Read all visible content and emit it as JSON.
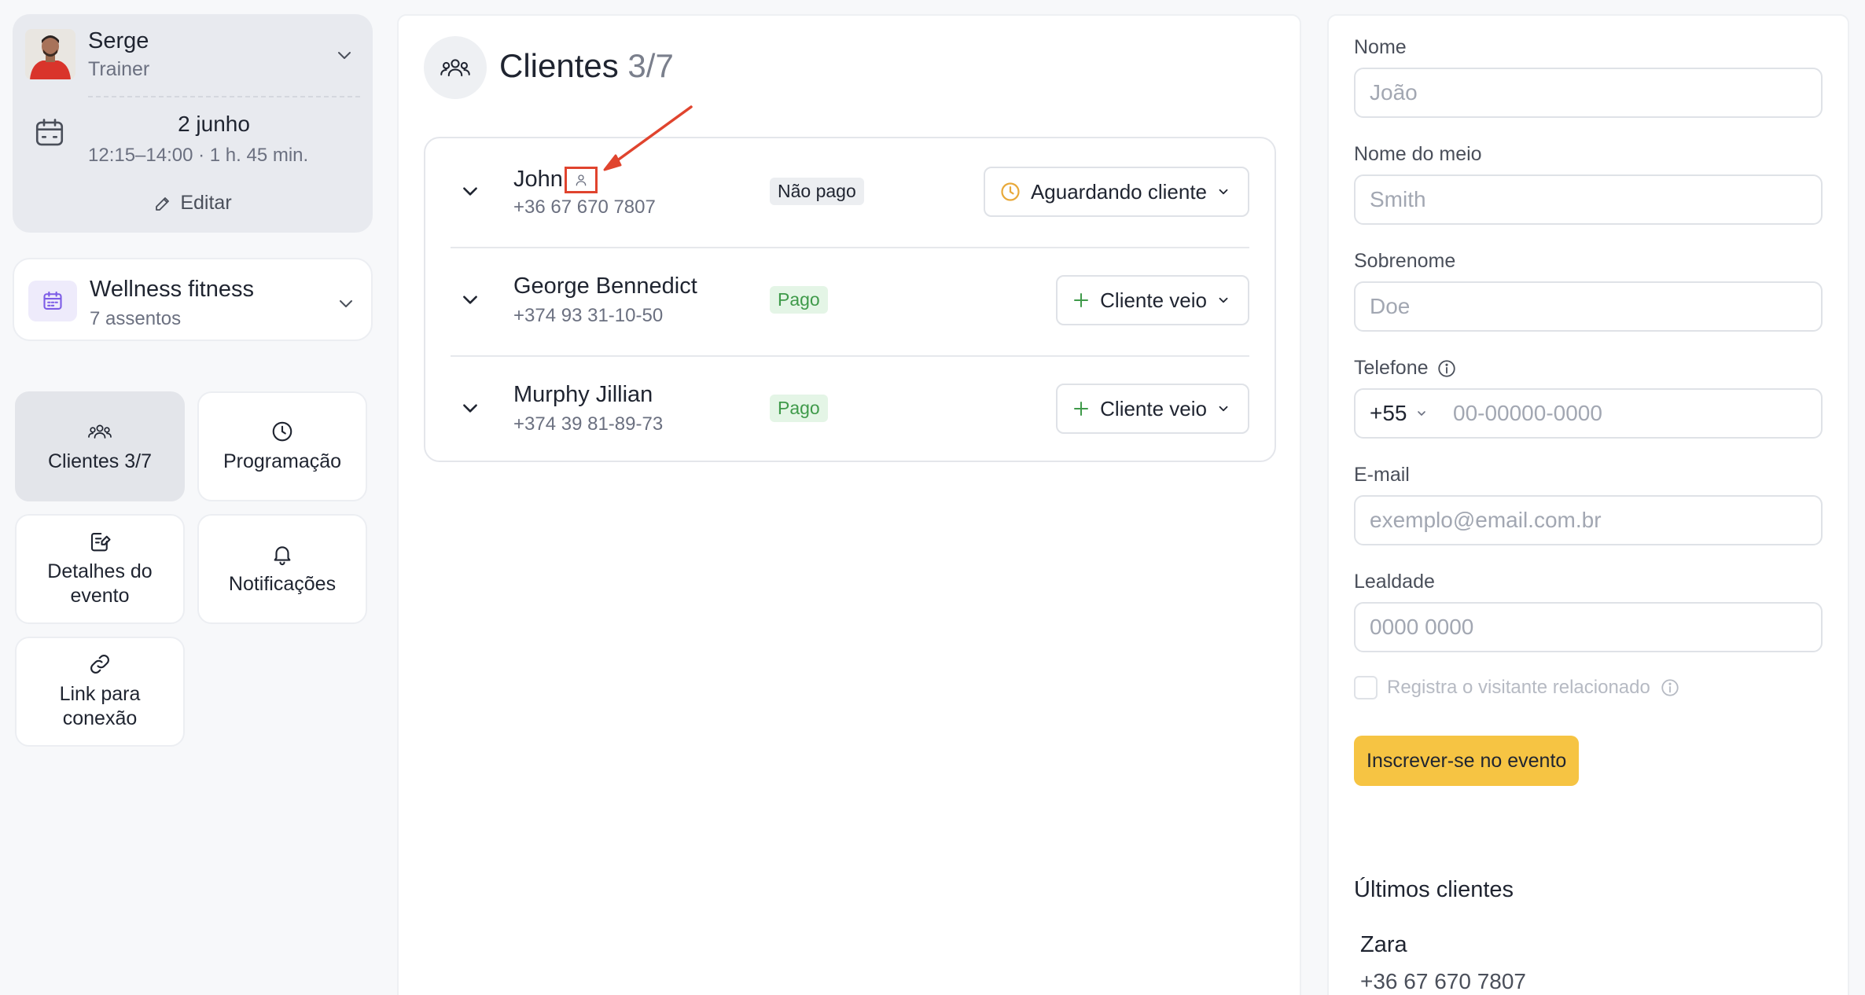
{
  "trainer": {
    "name": "Serge",
    "role": "Trainer",
    "date": "2 junho",
    "time": "12:15–14:00 · 1 h. 45 min.",
    "edit_label": "Editar"
  },
  "service": {
    "name": "Wellness fitness",
    "seats": "7 assentos",
    "accent_color": "#7c5ce6"
  },
  "nav_tiles": [
    {
      "label": "Clientes 3/7",
      "icon": "users-icon",
      "active": true
    },
    {
      "label": "Programação",
      "icon": "clock-icon",
      "active": false
    },
    {
      "label": "Detalhes do evento",
      "icon": "edit-note-icon",
      "active": false
    },
    {
      "label": "Notificações",
      "icon": "bell-icon",
      "active": false
    },
    {
      "label": "Link para conexão",
      "icon": "link-icon",
      "active": false
    }
  ],
  "main": {
    "title": "Clientes",
    "count": "3/7",
    "clients": [
      {
        "name": "John",
        "phone": "+36 67 670 7807",
        "payment": "Não pago",
        "status": "Aguardando cliente",
        "status_icon": "clock-icon",
        "highlighted_icon": "person-icon"
      },
      {
        "name": "George Bennedict",
        "phone": "+374 93 31-10-50",
        "payment": "Pago",
        "status": "Cliente veio",
        "status_icon": "plus-icon"
      },
      {
        "name": "Murphy Jillian",
        "phone": "+374 39 81-89-73",
        "payment": "Pago",
        "status": "Cliente veio",
        "status_icon": "plus-icon"
      }
    ]
  },
  "form": {
    "first_name": {
      "label": "Nome",
      "placeholder": "João"
    },
    "middle_name": {
      "label": "Nome do meio",
      "placeholder": "Smith"
    },
    "last_name": {
      "label": "Sobrenome",
      "placeholder": "Doe"
    },
    "phone": {
      "label": "Telefone",
      "code": "+55",
      "placeholder": "00-00000-0000"
    },
    "email": {
      "label": "E-mail",
      "placeholder": "exemplo@email.com.br"
    },
    "loyalty": {
      "label": "Lealdade",
      "placeholder": "0000 0000"
    },
    "related_visitor_label": "Registra o visitante relacionado",
    "submit_label": "Inscrever-se no evento",
    "submit_color": "#f6c443"
  },
  "recent": {
    "title": "Últimos clientes",
    "items": [
      {
        "name": "Zara",
        "phone": "+36 67 670 7807"
      }
    ]
  },
  "colors": {
    "paid": "#3f9a4a",
    "pending": "#e8a93a",
    "annotation": "#e0442e"
  }
}
